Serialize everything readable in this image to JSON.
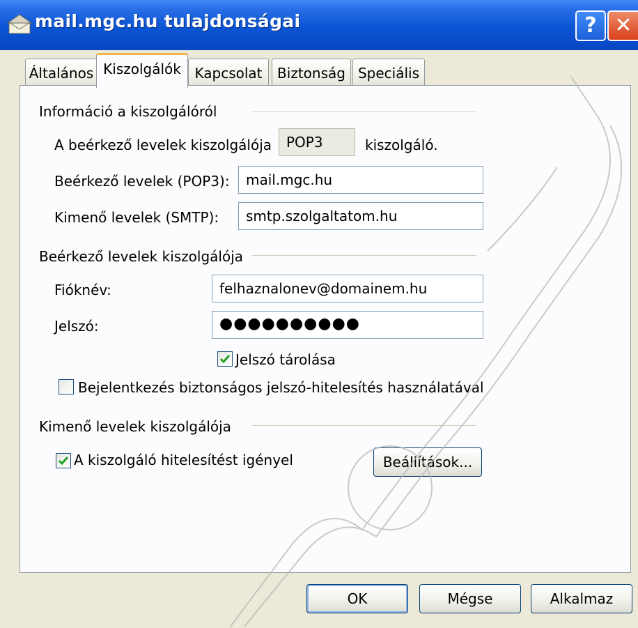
{
  "window": {
    "title": "mail.mgc.hu tulajdonságai",
    "help_label": "?",
    "close_label": "✕"
  },
  "tabs": [
    {
      "label": "Általános",
      "active": false
    },
    {
      "label": "Kiszolgálók",
      "active": true
    },
    {
      "label": "Kapcsolat",
      "active": false
    },
    {
      "label": "Biztonság",
      "active": false
    },
    {
      "label": "Speciális",
      "active": false
    }
  ],
  "server_info": {
    "heading": "Információ a kiszolgálóról",
    "incoming_type_label": "A beérkező levelek kiszolgálója",
    "incoming_type_value": "POP3",
    "incoming_type_suffix": "kiszolgáló.",
    "incoming_label": "Beérkező levelek (POP3):",
    "incoming_value": "mail.mgc.hu",
    "outgoing_label": "Kimenő levelek (SMTP):",
    "outgoing_value": "smtp.szolgaltatom.hu"
  },
  "incoming_server": {
    "heading": "Beérkező levelek kiszolgálója",
    "account_label": "Fióknév:",
    "account_value": "felhaznalonev@domainem.hu",
    "password_label": "Jelszó:",
    "password_value": "●●●●●●●●●●",
    "remember_label": "Jelszó tárolása",
    "remember_checked": true,
    "spa_label": "Bejelentkezés biztonságos jelszó-hitelesítés használatával",
    "spa_checked": false
  },
  "outgoing_server": {
    "heading": "Kimenő levelek kiszolgálója",
    "auth_label": "A kiszolgáló hitelesítést igényel",
    "auth_checked": true,
    "settings_button": "Beállítások..."
  },
  "buttons": {
    "ok": "OK",
    "cancel": "Mégse",
    "apply": "Alkalmaz"
  },
  "colors": {
    "titlebar": "#0a55d4",
    "dialog_bg": "#ece9d8",
    "panel_bg": "#fcfcfe",
    "active_tab_accent": "#f7b64a",
    "checkmark": "#21a121"
  }
}
